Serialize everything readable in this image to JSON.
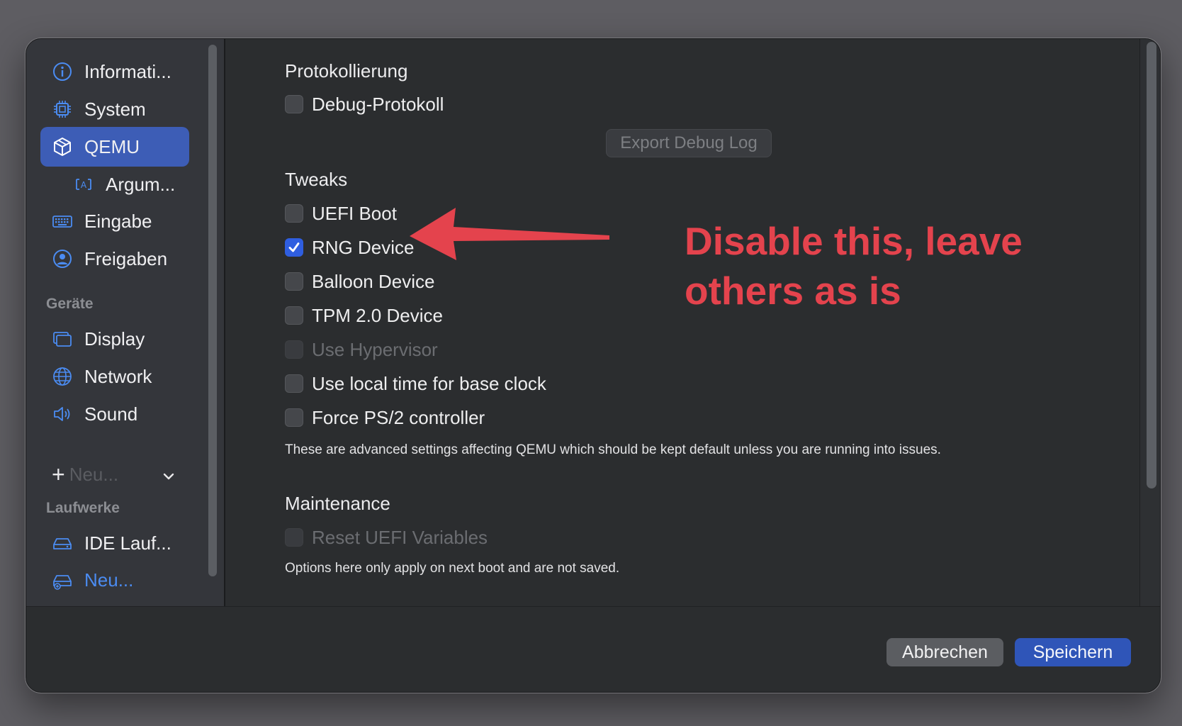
{
  "sidebar": {
    "items": [
      {
        "label": "Informati...",
        "icon": "info-icon"
      },
      {
        "label": "System",
        "icon": "cpu-icon"
      },
      {
        "label": "QEMU",
        "icon": "cube-icon"
      },
      {
        "label": "Argum...",
        "icon": "text-field-icon"
      },
      {
        "label": "Eingabe",
        "icon": "keyboard-icon"
      },
      {
        "label": "Freigaben",
        "icon": "person-circle-icon"
      }
    ],
    "devices_heading": "Geräte",
    "devices": [
      {
        "label": "Display",
        "icon": "display-icon"
      },
      {
        "label": "Network",
        "icon": "globe-icon"
      },
      {
        "label": "Sound",
        "icon": "speaker-icon"
      }
    ],
    "new_device_label": "Neu...",
    "drives_heading": "Laufwerke",
    "drives": [
      {
        "label": "IDE Lauf...",
        "icon": "drive-icon"
      },
      {
        "label": "Neu...",
        "icon": "add-drive-icon"
      }
    ]
  },
  "logging": {
    "heading": "Protokollierung",
    "debug_log_label": "Debug-Protokoll",
    "debug_log_checked": false,
    "export_button": "Export Debug Log"
  },
  "tweaks": {
    "heading": "Tweaks",
    "options": [
      {
        "label": "UEFI Boot",
        "checked": false,
        "disabled": false
      },
      {
        "label": "RNG Device",
        "checked": true,
        "disabled": false
      },
      {
        "label": "Balloon Device",
        "checked": false,
        "disabled": false
      },
      {
        "label": "TPM 2.0 Device",
        "checked": false,
        "disabled": false
      },
      {
        "label": "Use Hypervisor",
        "checked": false,
        "disabled": true
      },
      {
        "label": "Use local time for base clock",
        "checked": false,
        "disabled": false
      },
      {
        "label": "Force PS/2 controller",
        "checked": false,
        "disabled": false
      }
    ],
    "note": "These are advanced settings affecting QEMU which should be kept default unless you are running into issues."
  },
  "maintenance": {
    "heading": "Maintenance",
    "reset_uefi_label": "Reset UEFI Variables",
    "note": "Options here only apply on next boot and are not saved."
  },
  "annotation": {
    "line1": "Disable this, leave",
    "line2": "others as is",
    "color": "#e4434d"
  },
  "footer": {
    "cancel_label": "Abbrechen",
    "save_label": "Speichern"
  },
  "colors": {
    "accent": "#3d5db6",
    "checkbox_checked": "#2f5ee0",
    "link": "#4b8cf2"
  }
}
